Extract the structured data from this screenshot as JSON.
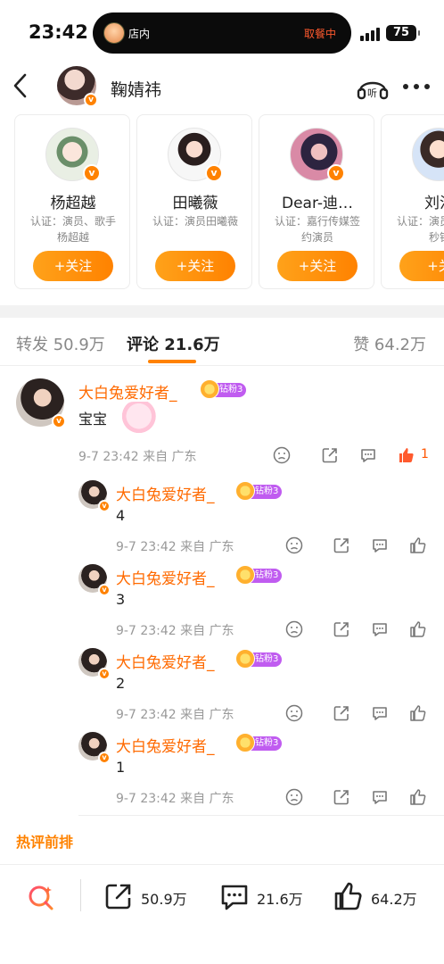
{
  "status": {
    "time": "23:42",
    "island_left": "店内",
    "island_right": "取餐中",
    "battery": "75"
  },
  "nav": {
    "title": "鞠婧祎"
  },
  "cards": [
    {
      "name": "杨超越",
      "desc": "认证：演员、歌手杨超越",
      "follow": "+关注"
    },
    {
      "name": "田曦薇",
      "desc": "认证：演员田曦薇",
      "follow": "+关注"
    },
    {
      "name": "Dear-迪…",
      "desc": "认证：嘉行传媒签约演员",
      "follow": "+关注"
    },
    {
      "name": "刘浩",
      "desc": "认证：演员作：一秒钟",
      "follow": "+关"
    }
  ],
  "tabs": {
    "repost": "转发 50.9万",
    "comment": "评论 21.6万",
    "like": "赞 64.2万"
  },
  "main_comment": {
    "user": "大白兔爱好者_",
    "badge": "钻粉3",
    "text": "宝宝",
    "meta": "9-7 23:42  来自 广东",
    "likes": "1"
  },
  "replies": [
    {
      "user": "大白兔爱好者_",
      "badge": "钻粉3",
      "text": "4",
      "meta": "9-7 23:42  来自 广东"
    },
    {
      "user": "大白兔爱好者_",
      "badge": "钻粉3",
      "text": "3",
      "meta": "9-7 23:42  来自 广东"
    },
    {
      "user": "大白兔爱好者_",
      "badge": "钻粉3",
      "text": "2",
      "meta": "9-7 23:42  来自 广东"
    },
    {
      "user": "大白兔爱好者_",
      "badge": "钻粉3",
      "text": "1",
      "meta": "9-7 23:42  来自 广东"
    }
  ],
  "hot_label": "热评前排",
  "bottom": {
    "repost": "50.9万",
    "comment": "21.6万",
    "like": "64.2万"
  },
  "colors": {
    "accent": "#ff8200",
    "username": "#ff6a00",
    "fan_badge": "#c05cf0"
  }
}
